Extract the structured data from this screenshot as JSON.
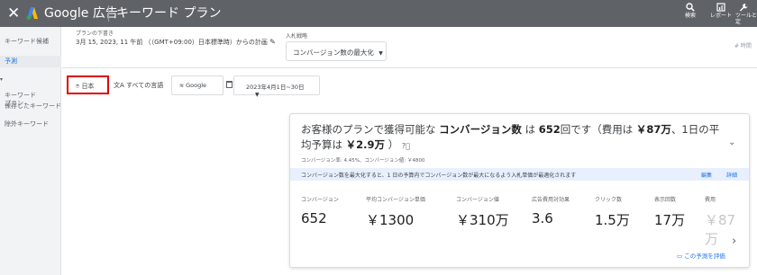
{
  "topbar": {
    "brand": "Google 広告",
    "title": "キーワード プラン",
    "tools": [
      {
        "label": "検索",
        "icon": "search-icon"
      },
      {
        "label": "レポート",
        "icon": "report-icon"
      },
      {
        "label": "ツールと設定",
        "icon": "wrench-icon"
      }
    ]
  },
  "nav": {
    "items": [
      {
        "label": "キーワード候補",
        "active": false
      },
      {
        "label": "予測",
        "active": true
      },
      {
        "label": "キーワード\nプラン",
        "active": false
      },
      {
        "label": "保存したキーワード",
        "active": false
      },
      {
        "label": "除外キーワード",
        "active": false
      }
    ]
  },
  "header": {
    "plan_label": "プランの下書き",
    "plan_date": "3月 15, 2023, 11 午前 （（GMT+09:00）日本標準時）からの計画",
    "bid_label": "入札戦略",
    "bid_value": "コンバージョン数の最大化",
    "right_hint": "# 時間"
  },
  "filters": {
    "location": "日本",
    "language": "すべての言語",
    "network": "Google",
    "date_range": "2023年4月1日~30日"
  },
  "card": {
    "title_prefix": "お客様のプランで獲得可能な",
    "title_metric": "コンバージョン数",
    "title_mid1": "は",
    "title_count": "652",
    "title_mid2": "回です（費用は",
    "title_cost": "￥87万",
    "title_mid3": "、1日の平均予算は",
    "title_budget": "￥2.9万",
    "title_suffix": "）",
    "meta": "コンバージョン率: 4.45%、コンバージョン値: ￥4800",
    "banner_text": "コンバージョン数を最大化すると、1 日の予算内でコンバージョン数が最大になるよう入札単価が最適化されます",
    "banner_edit": "編集",
    "banner_detail": "詳細",
    "metrics": [
      {
        "label": "コンバージョン",
        "value": "652"
      },
      {
        "label": "平均コンバージョン単価",
        "value": "￥1300"
      },
      {
        "label": "コンバージョン値",
        "value": "￥310万"
      },
      {
        "label": "広告費用対効果",
        "value": "3.6"
      },
      {
        "label": "クリック数",
        "value": "1.5万"
      },
      {
        "label": "表示回数",
        "value": "17万"
      },
      {
        "label": "費用",
        "value": "￥87万"
      }
    ],
    "rate_link": "この予測を評価"
  },
  "colors": {
    "topbar": "#5f6368",
    "accent": "#1a73e8",
    "highlight_border": "#e00000",
    "banner": "#e8f0fe"
  }
}
